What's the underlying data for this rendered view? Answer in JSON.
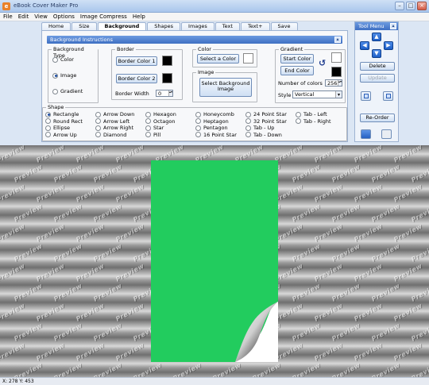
{
  "window": {
    "title": "eBook Cover Maker Pro",
    "icon": "app-icon"
  },
  "menu": [
    "File",
    "Edit",
    "View",
    "Options",
    "Image Compress",
    "Help"
  ],
  "tabs": [
    {
      "label": "Home",
      "active": false
    },
    {
      "label": "Size",
      "active": false
    },
    {
      "label": "Background",
      "active": true
    },
    {
      "label": "Shapes",
      "active": false
    },
    {
      "label": "Images",
      "active": false
    },
    {
      "label": "Text",
      "active": false
    },
    {
      "label": "Text+",
      "active": false
    },
    {
      "label": "Save",
      "active": false
    }
  ],
  "section": {
    "title": "Background Instructions"
  },
  "background_type": {
    "legend": "Background Type",
    "options": [
      {
        "label": "Color",
        "selected": false
      },
      {
        "label": "Image",
        "selected": true
      },
      {
        "label": "Gradient",
        "selected": false
      }
    ]
  },
  "border": {
    "legend": "Border",
    "color1_label": "Border Color 1",
    "color1": "#000000",
    "color2_label": "Border Color 2",
    "color2": "#000000",
    "width_label": "Border Width",
    "width_value": "0"
  },
  "color": {
    "legend": "Color",
    "select_label": "Select a Color",
    "swatch": "#ffffff"
  },
  "image": {
    "legend": "Image",
    "select_label": "Select Background Image"
  },
  "gradient": {
    "legend": "Gradient",
    "start_label": "Start Color",
    "start_color": "#ffffff",
    "end_label": "End Color",
    "end_color": "#000000",
    "num_colors_label": "Number of colors",
    "num_colors_value": "256",
    "style_label": "Style",
    "style_value": "Vertical"
  },
  "shape": {
    "legend": "Shape",
    "options": [
      [
        "Rectangle",
        "Round Rect",
        "Ellipse",
        "Arrow Up"
      ],
      [
        "Arrow Down",
        "Arrow Left",
        "Arrow Right",
        "Diamond"
      ],
      [
        "Hexagon",
        "Octagon",
        "Star",
        "Pill"
      ],
      [
        "Honeycomb",
        "Heptagon",
        "Pentagon",
        "16 Point Star"
      ],
      [
        "24 Point Star",
        "32 Point Star",
        "Tab - Up",
        "Tab - Down"
      ],
      [
        "Tab - Left",
        "Tab - Right"
      ]
    ],
    "selected": "Rectangle"
  },
  "tool_menu": {
    "title": "Tool Menu",
    "delete_label": "Delete",
    "update_label": "Update",
    "reorder_label": "Re-Order"
  },
  "preview": {
    "watermark": "Preview",
    "cover_color": "#22cc5e",
    "background_color": "#8c8c8c"
  },
  "status": {
    "coords": "X: 278  Y: 453"
  }
}
